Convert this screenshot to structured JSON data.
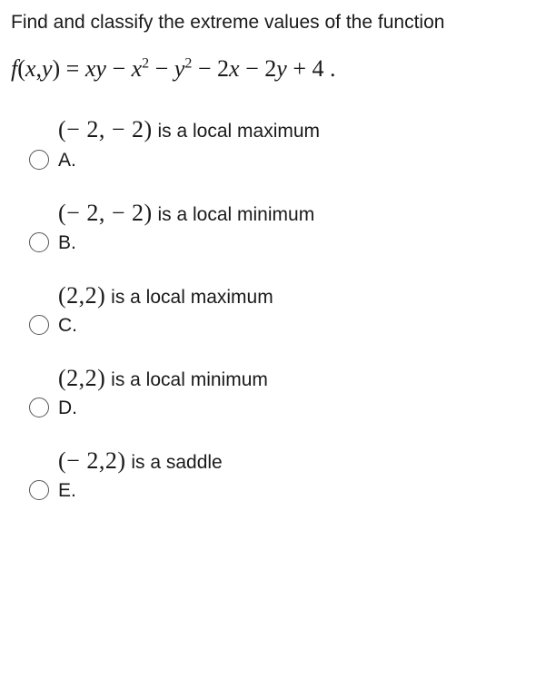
{
  "question": {
    "prompt": "Find and classify the extreme values of the function",
    "function_lhs": "f(x,y)",
    "function_rhs": "= xy − x² − y² − 2x − 2y + 4 ."
  },
  "options": [
    {
      "letter": "A.",
      "math": "(− 2, − 2)",
      "desc": " is a local maximum"
    },
    {
      "letter": "B.",
      "math": "(− 2, − 2)",
      "desc": " is a local minimum"
    },
    {
      "letter": "C.",
      "math": "(2,2)",
      "desc": " is a local maximum"
    },
    {
      "letter": "D.",
      "math": "(2,2)",
      "desc": " is a local minimum"
    },
    {
      "letter": "E.",
      "math": "(− 2,2)",
      "desc": " is a saddle"
    }
  ]
}
